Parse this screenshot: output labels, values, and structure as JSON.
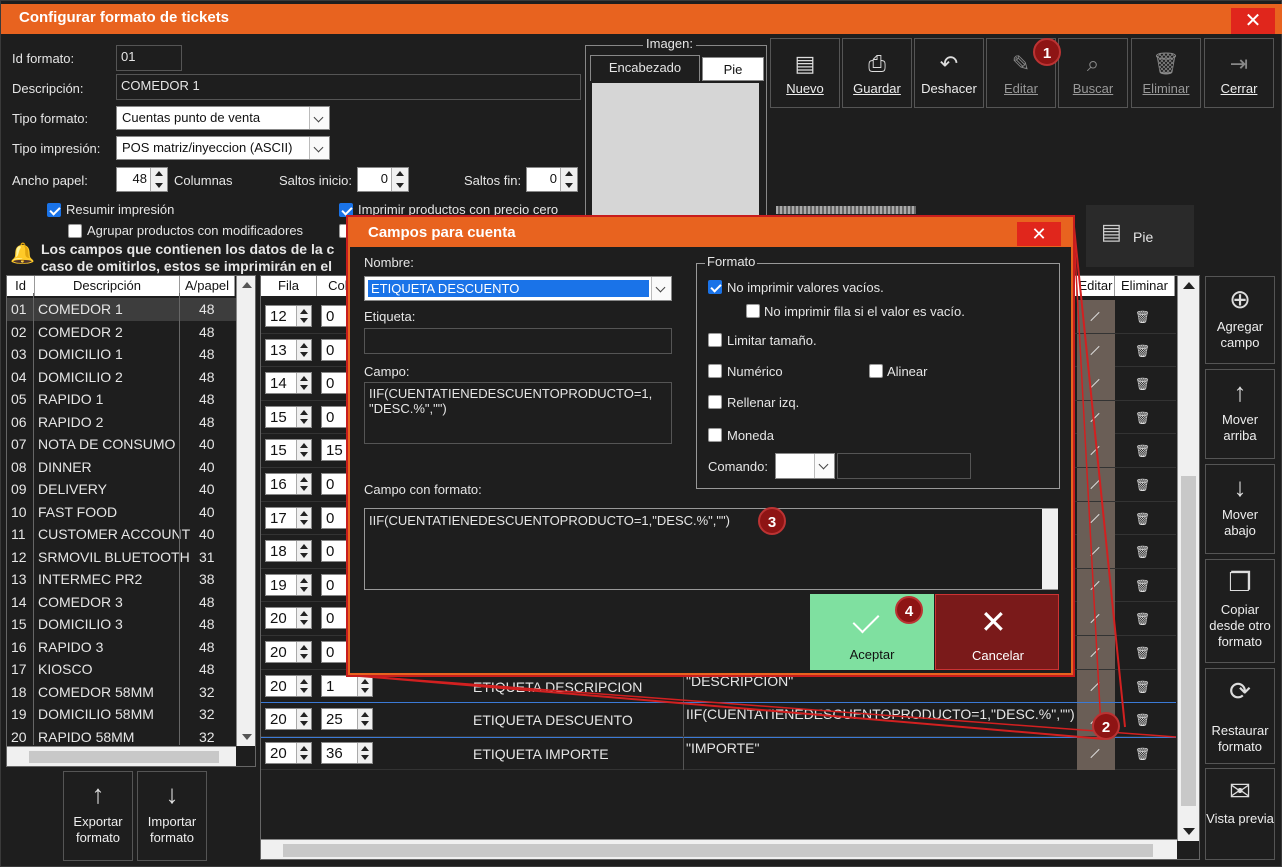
{
  "window": {
    "title": "Configurar formato de tickets",
    "close": "✕"
  },
  "form": {
    "id_label": "Id formato:",
    "id_value": "01",
    "desc_label": "Descripción:",
    "desc_value": "COMEDOR 1",
    "tipo_label": "Tipo formato:",
    "tipo_value": "Cuentas punto de venta",
    "impresion_label": "Tipo impresión:",
    "impresion_value": "POS matriz/inyeccion (ASCII)",
    "ancho_label": "Ancho papel:",
    "ancho_value": "48",
    "columnas_label": "Columnas",
    "saltos_inicio_label": "Saltos inicio:",
    "saltos_inicio_value": "0",
    "saltos_fin_label": "Saltos fin:",
    "saltos_fin_value": "0",
    "resumir_label": "Resumir impresión",
    "agrupar_label": "Agrupar productos con modificadores",
    "imprimir_cero_label": "Imprimir productos con precio cero",
    "warning_line1": "Los campos que contienen los datos de la c",
    "warning_line2": "caso de omitirlos, estos se imprimirán en el"
  },
  "imagen": {
    "title": "Imagen:",
    "tab1": "Encabezado",
    "tab2": "Pie"
  },
  "toolbar": [
    {
      "label": "Nuevo",
      "icon": "new-doc-icon"
    },
    {
      "label": "Guardar",
      "icon": "save-icon"
    },
    {
      "label": "Deshacer",
      "icon": "undo-icon"
    },
    {
      "label": "Editar",
      "icon": "edit-icon"
    },
    {
      "label": "Buscar",
      "icon": "search-icon"
    },
    {
      "label": "Eliminar",
      "icon": "trash-icon"
    },
    {
      "label": "Cerrar",
      "icon": "exit-icon"
    }
  ],
  "pie_tab": "Pie",
  "list": {
    "headers": [
      "Id",
      "Descripción",
      "A/papel"
    ],
    "rows": [
      [
        "01",
        "COMEDOR 1",
        "48"
      ],
      [
        "02",
        "COMEDOR 2",
        "48"
      ],
      [
        "03",
        "DOMICILIO 1",
        "48"
      ],
      [
        "04",
        "DOMICILIO 2",
        "48"
      ],
      [
        "05",
        "RAPIDO 1",
        "48"
      ],
      [
        "06",
        "RAPIDO 2",
        "48"
      ],
      [
        "07",
        "NOTA DE CONSUMO",
        "40"
      ],
      [
        "08",
        "DINNER",
        "40"
      ],
      [
        "09",
        "DELIVERY",
        "40"
      ],
      [
        "10",
        "FAST FOOD",
        "40"
      ],
      [
        "11",
        "CUSTOMER ACCOUNT",
        "40"
      ],
      [
        "12",
        "SRMOVIL BLUETOOTH",
        "31"
      ],
      [
        "13",
        "INTERMEC PR2",
        "38"
      ],
      [
        "14",
        "COMEDOR 3",
        "48"
      ],
      [
        "15",
        "DOMICILIO 3",
        "48"
      ],
      [
        "16",
        "RAPIDO 3",
        "48"
      ],
      [
        "17",
        "KIOSCO",
        "48"
      ],
      [
        "18",
        "COMEDOR 58MM",
        "32"
      ],
      [
        "19",
        "DOMICILIO 58MM",
        "32"
      ],
      [
        "20",
        "RAPIDO 58MM",
        "32"
      ]
    ]
  },
  "left_buttons": [
    {
      "label": "Exportar formato",
      "icon": "arrow-up-icon"
    },
    {
      "label": "Importar formato",
      "icon": "arrow-down-icon"
    }
  ],
  "fields_grid": {
    "headers": [
      "Fila",
      "Colu",
      "Editar",
      "Eliminar"
    ],
    "rows": [
      {
        "fila": "12",
        "col": "0",
        "etiqueta": "",
        "campo": ""
      },
      {
        "fila": "13",
        "col": "0",
        "etiqueta": "",
        "campo": ""
      },
      {
        "fila": "14",
        "col": "0",
        "etiqueta": "",
        "campo": ""
      },
      {
        "fila": "15",
        "col": "0",
        "etiqueta": "",
        "campo": ""
      },
      {
        "fila": "15",
        "col": "15",
        "etiqueta": "",
        "campo": ""
      },
      {
        "fila": "16",
        "col": "0",
        "etiqueta": "",
        "campo": ""
      },
      {
        "fila": "17",
        "col": "0",
        "etiqueta": "",
        "campo": ""
      },
      {
        "fila": "18",
        "col": "0",
        "etiqueta": "",
        "campo": ""
      },
      {
        "fila": "19",
        "col": "0",
        "etiqueta": "",
        "campo": ""
      },
      {
        "fila": "20",
        "col": "0",
        "etiqueta": "",
        "campo": ""
      },
      {
        "fila": "20",
        "col": "0",
        "etiqueta": "",
        "campo": ""
      },
      {
        "fila": "20",
        "col": "1",
        "etiqueta": "ETIQUETA DESCRIPCION",
        "campo": "\"DESCRIPCION\""
      },
      {
        "fila": "20",
        "col": "25",
        "etiqueta": "ETIQUETA DESCUENTO",
        "campo": "IIF(CUENTATIENEDESCUENTOPRODUCTO=1,\"DESC.%\",\"\")"
      },
      {
        "fila": "20",
        "col": "36",
        "etiqueta": "ETIQUETA IMPORTE",
        "campo": "\"IMPORTE\""
      }
    ]
  },
  "side_buttons": [
    {
      "label": "Agregar campo",
      "icon": "plus-circle-icon"
    },
    {
      "label": "Mover arriba",
      "icon": "arrow-up-icon"
    },
    {
      "label": "Mover abajo",
      "icon": "arrow-down-icon"
    },
    {
      "label": "Copiar desde otro formato",
      "icon": "copy-icon"
    },
    {
      "label": "Restaurar formato",
      "icon": "restore-icon"
    },
    {
      "label": "Vista previa",
      "icon": "preview-icon"
    }
  ],
  "dialog": {
    "title": "Campos para cuenta",
    "close": "✕",
    "nombre_label": "Nombre:",
    "nombre_value": "ETIQUETA DESCUENTO",
    "etiqueta_label": "Etiqueta:",
    "etiqueta_value": "",
    "campo_label": "Campo:",
    "campo_value": "IIF(CUENTATIENEDESCUENTOPRODUCTO=1, \"DESC.%\",\"\")",
    "campo_formato_label": "Campo con formato:",
    "campo_formato_value": "IIF(CUENTATIENEDESCUENTOPRODUCTO=1,\"DESC.%\",\"\")",
    "formato_title": "Formato",
    "no_vacios": "No imprimir valores vacíos.",
    "no_fila": "No imprimir fila si el valor es vacío.",
    "limitar": "Limitar tamaño.",
    "numerico": "Numérico",
    "alinear": "Alinear",
    "rellenar": "Rellenar izq.",
    "moneda": "Moneda",
    "comando_label": "Comando:",
    "aceptar": "Aceptar",
    "cancelar": "Cancelar"
  },
  "badges": [
    "1",
    "2",
    "3",
    "4"
  ],
  "colors": {
    "accent": "#e8631f",
    "close": "#e0261c",
    "accept": "#7fe0a0",
    "cancel": "#7a1a1a",
    "badge": "#8e1414",
    "highlight": "#d22020"
  }
}
